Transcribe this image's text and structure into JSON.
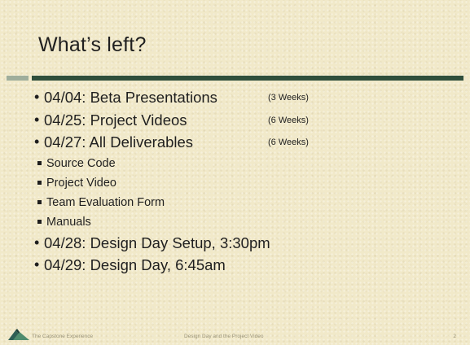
{
  "slide": {
    "title": "What’s left?",
    "items": [
      {
        "level": 1,
        "text": "04/04: Beta Presentations",
        "note": "(3 Weeks)"
      },
      {
        "level": 1,
        "text": "04/25: Project Videos",
        "note": "(6 Weeks)"
      },
      {
        "level": 1,
        "text": "04/27: All Deliverables",
        "note": "(6 Weeks)"
      },
      {
        "level": 2,
        "text": "Source Code"
      },
      {
        "level": 2,
        "text": "Project Video"
      },
      {
        "level": 2,
        "text": "Team Evaluation Form"
      },
      {
        "level": 2,
        "text": "Manuals"
      },
      {
        "level": 1,
        "text": "04/28: Design Day Setup, 3:30pm"
      },
      {
        "level": 1,
        "text": "04/29: Design Day, 6:45am"
      }
    ]
  },
  "footer": {
    "left": "The Capstone Experience",
    "center": "Design Day and the Project Video",
    "page": "2"
  },
  "colors": {
    "background": "#f1e9c9",
    "rule": "#2f4f3c",
    "rule_accent": "#9fae9c",
    "text": "#1f1f1f",
    "footer_text": "#9a9479"
  },
  "icons": {
    "footer_logo": "mountain-logo-icon"
  }
}
